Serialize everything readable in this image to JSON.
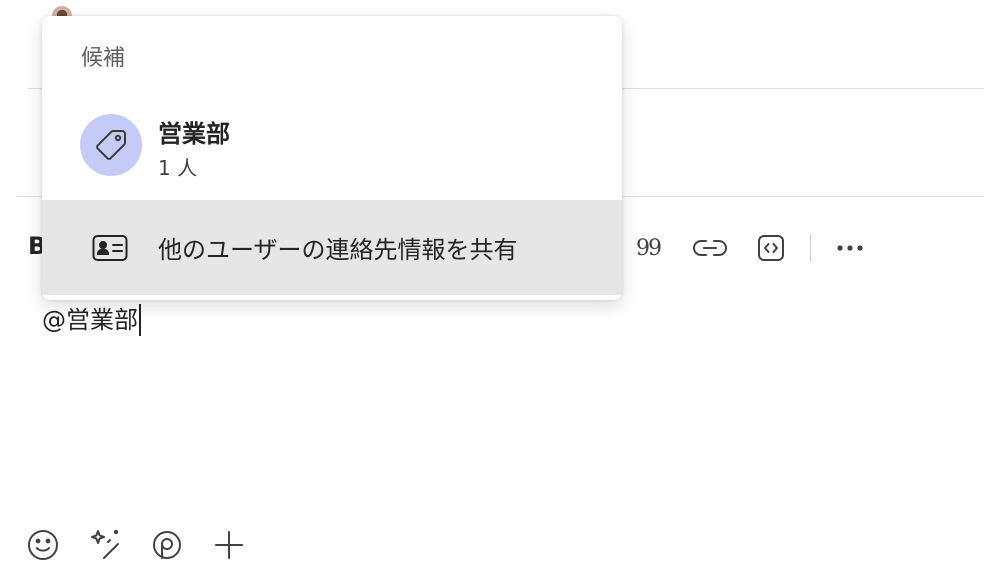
{
  "popup": {
    "header": "候補",
    "suggestion": {
      "name": "営業部",
      "member_count": "1 人",
      "icon": "tag-icon",
      "avatar_color": "#c5cbf7"
    },
    "share_contact": {
      "label": "他のユーザーの連絡先情報を共有",
      "icon": "contact-card-icon",
      "highlighted": true
    }
  },
  "toolbar": {
    "partial_bold_label": "B",
    "quote_glyph": "99",
    "items": [
      "quote-icon",
      "link-icon",
      "code-snippet-icon",
      "more-options-icon"
    ]
  },
  "compose": {
    "text": "@営業部"
  },
  "bottom_bar": {
    "items": [
      "emoji-icon",
      "copilot-sparkle-icon",
      "loop-component-icon",
      "add-icon"
    ]
  },
  "colors": {
    "highlight": "#e6e6e6",
    "tag_avatar": "#c5cbf7",
    "text": "#242424"
  }
}
